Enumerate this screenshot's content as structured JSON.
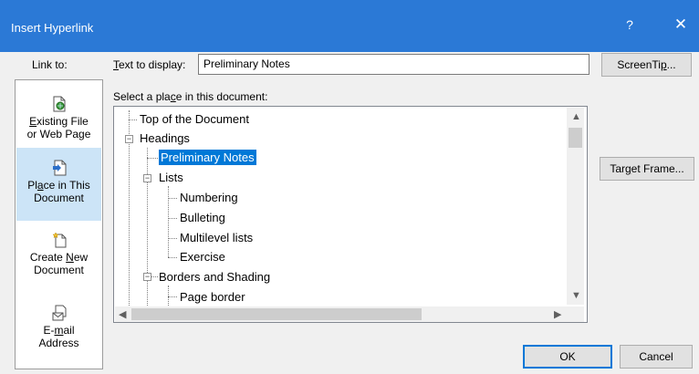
{
  "window": {
    "title": "Insert Hyperlink",
    "help_glyph": "?",
    "close_glyph": "✕"
  },
  "link_to": {
    "label": "Link to:",
    "items": [
      {
        "pre": "",
        "u": "E",
        "post": "xisting File",
        "line2": "or Web Page",
        "icon": "web-page-icon"
      },
      {
        "pre": "Pl",
        "u": "a",
        "post": "ce in This",
        "line2": "Document",
        "icon": "place-in-document-icon"
      },
      {
        "pre": "Create ",
        "u": "N",
        "post": "ew",
        "line2": "Document",
        "icon": "new-document-icon"
      },
      {
        "pre": "E-",
        "u": "m",
        "post": "ail",
        "line2": "Address",
        "icon": "email-icon"
      }
    ]
  },
  "text_to_display": {
    "label_u": "T",
    "label_rest": "ext to display:",
    "value": "Preliminary Notes"
  },
  "buttons": {
    "screentip_pre": "ScreenTi",
    "screentip_u": "p",
    "screentip_post": "...",
    "target_pre": "Tar",
    "target_u": "g",
    "target_post": "et Frame...",
    "ok": "OK",
    "cancel": "Cancel"
  },
  "place": {
    "label_pre": "Select a pla",
    "label_u": "c",
    "label_post": "e in this document:"
  },
  "tree": {
    "items": [
      {
        "label": "Top of the Document",
        "level": 0,
        "expander": false
      },
      {
        "label": "Headings",
        "level": 0,
        "expander": true
      },
      {
        "label": "Preliminary Notes",
        "level": 1,
        "expander": false,
        "selected": true
      },
      {
        "label": "Lists",
        "level": 1,
        "expander": true
      },
      {
        "label": "Numbering",
        "level": 2,
        "expander": false
      },
      {
        "label": "Bulleting",
        "level": 2,
        "expander": false
      },
      {
        "label": "Multilevel lists",
        "level": 2,
        "expander": false
      },
      {
        "label": "Exercise",
        "level": 2,
        "expander": false
      },
      {
        "label": "Borders and Shading",
        "level": 1,
        "expander": true
      },
      {
        "label": "Page border",
        "level": 2,
        "expander": false
      }
    ],
    "expander_glyph": "−",
    "scroll_up": "▲",
    "scroll_down": "▼",
    "scroll_left": "◀",
    "scroll_right": "▶"
  },
  "colors": {
    "titlebar": "#2b79d6",
    "selection": "#0078d7",
    "link_selected": "#cce4f7"
  }
}
